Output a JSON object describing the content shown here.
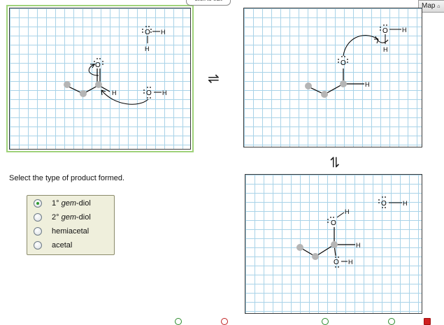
{
  "tooltip_text": "click to edit",
  "map_button": {
    "label": "Map",
    "sub": "⌂"
  },
  "equilibrium_symbol": "⇌",
  "question": "Select the type of product formed.",
  "options": [
    {
      "label_pre": "1° ",
      "label_italic": "gem",
      "label_post": "-diol",
      "selected": true
    },
    {
      "label_pre": "2° ",
      "label_italic": "gem",
      "label_post": "-diol",
      "selected": false
    },
    {
      "label_pre": "hemiacetal",
      "label_italic": "",
      "label_post": "",
      "selected": false
    },
    {
      "label_pre": "acetal",
      "label_italic": "",
      "label_post": "",
      "selected": false
    }
  ],
  "atoms": {
    "O": "O",
    "H": "H"
  },
  "colors": {
    "grid_line": "#a9d3e8",
    "active_outline": "#9fd27a",
    "selected_radio": "#2f9a2f",
    "option_panel": "#efefdc"
  }
}
